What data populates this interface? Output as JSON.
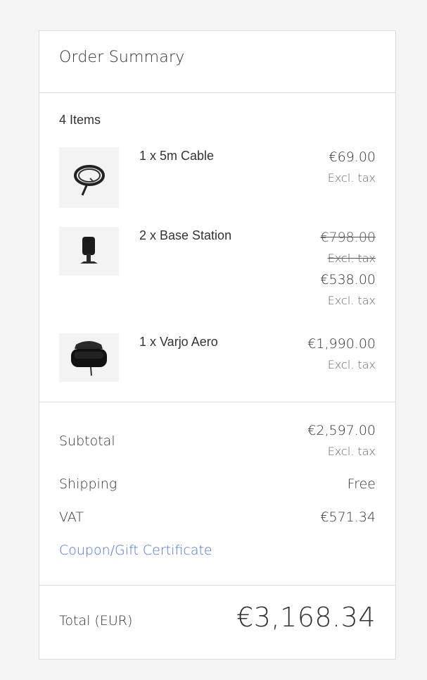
{
  "order_summary": {
    "title": "Order Summary",
    "items_count": "4 Items",
    "items": [
      {
        "name": "1 x 5m Cable",
        "image_icon": "cable-icon",
        "price": "€69.00",
        "tax_note": "Excl. tax"
      },
      {
        "name": "2 x Base Station",
        "image_icon": "base-station-icon",
        "original_price": "€798.00",
        "original_tax_note": "Excl. tax",
        "price": "€538.00",
        "tax_note": "Excl. tax"
      },
      {
        "name": "1 x Varjo Aero",
        "image_icon": "vr-headset-icon",
        "price": "€1,990.00",
        "tax_note": "Excl. tax"
      }
    ],
    "subtotal": {
      "label": "Subtotal",
      "value": "€2,597.00",
      "tax_note": "Excl. tax"
    },
    "shipping": {
      "label": "Shipping",
      "value": "Free"
    },
    "vat": {
      "label": "VAT",
      "value": "€571.34"
    },
    "coupon_link": "Coupon/Gift Certificate",
    "total": {
      "label": "Total (EUR)",
      "value": "€3,168.34"
    }
  },
  "colors": {
    "link": "#4a72e8",
    "border": "#dcdcdc",
    "background": "#f5f5f5",
    "card": "#ffffff"
  }
}
